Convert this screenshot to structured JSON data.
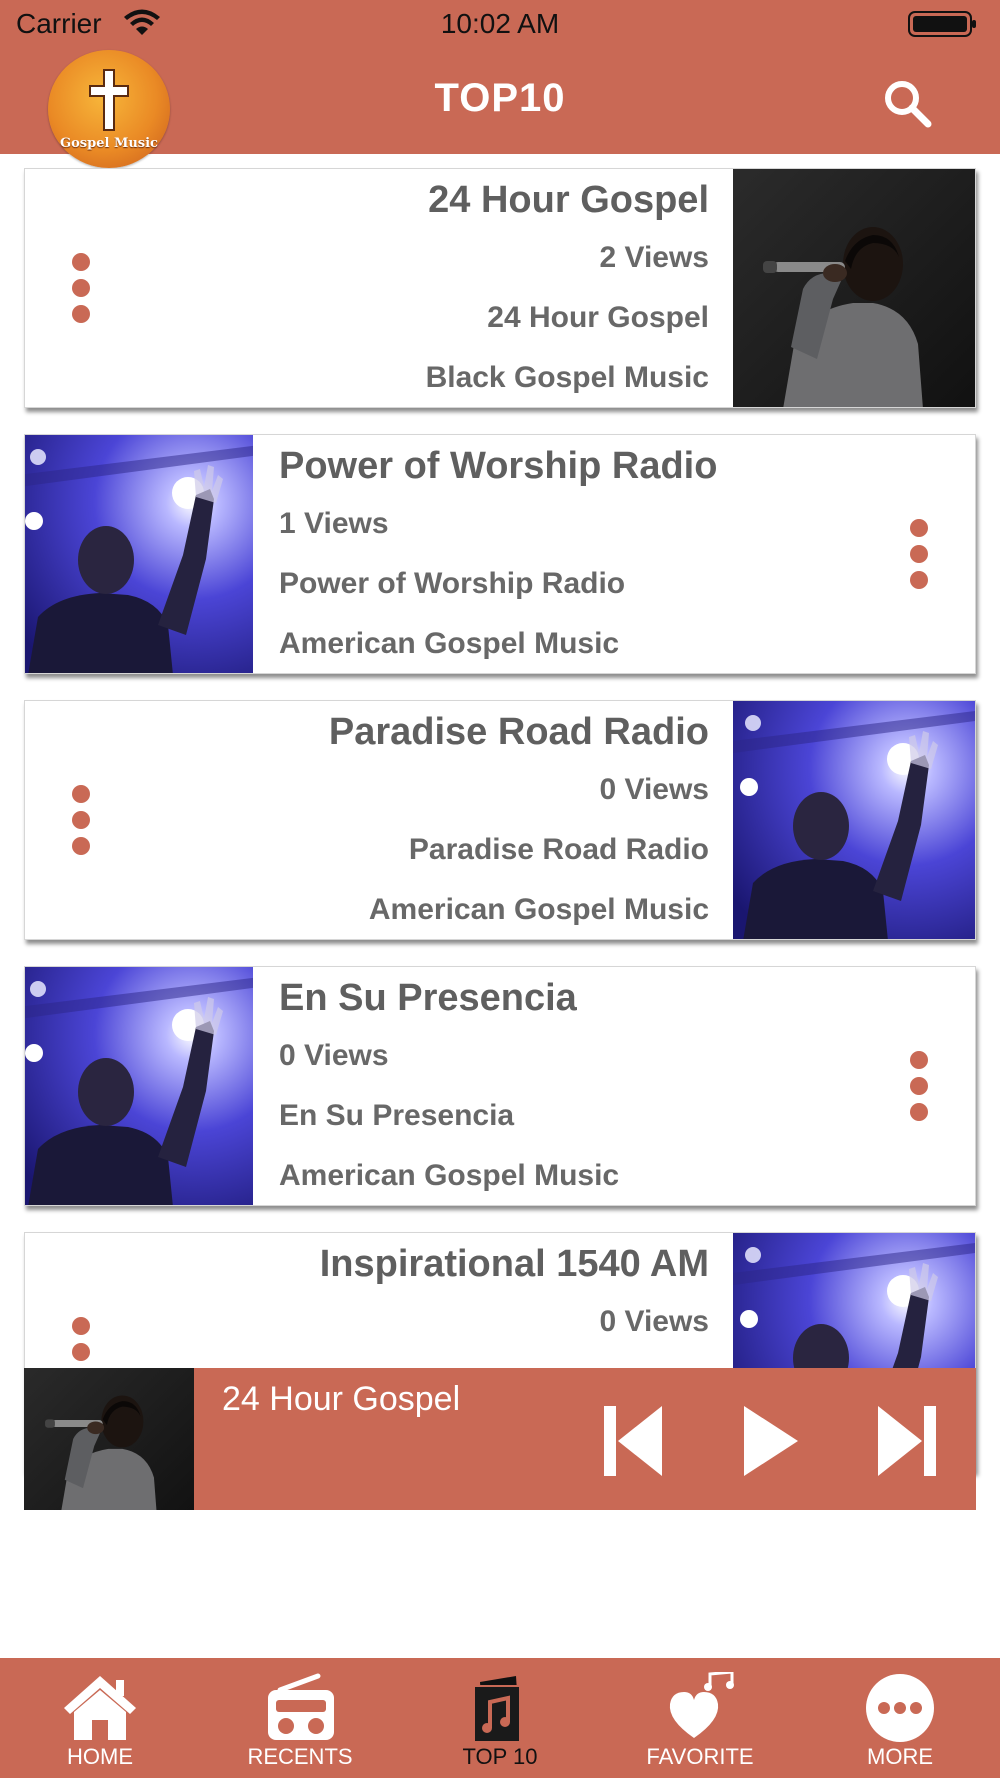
{
  "status_bar": {
    "carrier": "Carrier",
    "time": "10:02 AM"
  },
  "header": {
    "title": "TOP10",
    "logo_text": "Gospel Music",
    "search_icon": "search-icon",
    "accent_color": "#c96955"
  },
  "stations": [
    {
      "title": "24 Hour Gospel",
      "views": "2 Views",
      "subtitle": "24 Hour Gospel",
      "genre": "Black Gospel Music",
      "thumb": "singer-microphone-photo"
    },
    {
      "title": "Power of Worship Radio",
      "views": "1 Views",
      "subtitle": "Power of Worship Radio",
      "genre": "American Gospel Music",
      "thumb": "worship-concert-photo"
    },
    {
      "title": "Paradise Road Radio",
      "views": "0 Views",
      "subtitle": "Paradise Road Radio",
      "genre": "American Gospel Music",
      "thumb": "worship-concert-photo"
    },
    {
      "title": "En Su Presencia",
      "views": "0 Views",
      "subtitle": "En Su Presencia",
      "genre": "American Gospel Music",
      "thumb": "worship-concert-photo"
    },
    {
      "title": "Inspirational 1540 AM",
      "views": "0 Views",
      "thumb": "worship-concert-photo"
    }
  ],
  "now_playing": {
    "title": "24 Hour Gospel",
    "controls": [
      "previous-icon",
      "play-icon",
      "next-icon"
    ]
  },
  "tab_bar": {
    "active": "TOP 10",
    "tabs": [
      {
        "label": "HOME",
        "icon": "home-icon"
      },
      {
        "label": "RECENTS",
        "icon": "radio-icon"
      },
      {
        "label": "TOP 10",
        "icon": "music-note-icon"
      },
      {
        "label": "FAVORITE",
        "icon": "heart-music-icon"
      },
      {
        "label": "MORE",
        "icon": "more-icon"
      }
    ]
  }
}
